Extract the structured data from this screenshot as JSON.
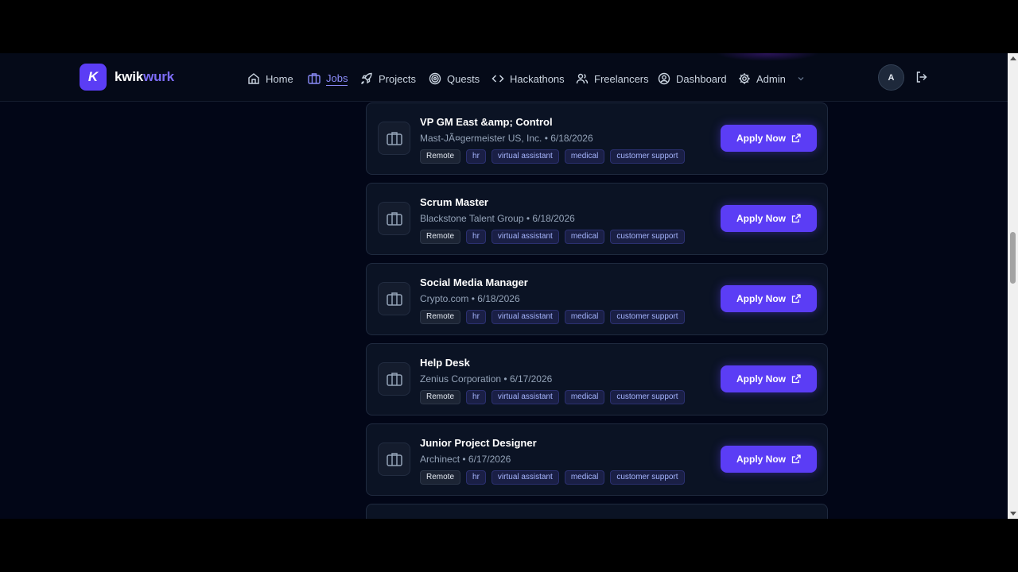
{
  "brand": {
    "logo_letter": "K",
    "name_part1": "kwik",
    "name_part2": "wurk"
  },
  "nav": [
    {
      "label": "Home",
      "icon": "home-icon",
      "active": false
    },
    {
      "label": "Jobs",
      "icon": "briefcase-icon",
      "active": true
    },
    {
      "label": "Projects",
      "icon": "rocket-icon",
      "active": false
    },
    {
      "label": "Quests",
      "icon": "target-icon",
      "active": false
    },
    {
      "label": "Hackathons",
      "icon": "code-icon",
      "active": false
    },
    {
      "label": "Freelancers",
      "icon": "users-icon",
      "active": false
    },
    {
      "label": "Dashboard",
      "icon": "user-circle-icon",
      "active": false
    },
    {
      "label": "Admin",
      "icon": "gear-icon",
      "active": false
    }
  ],
  "user": {
    "avatar_initial": "A"
  },
  "jobs": [
    {
      "title": "VP GM East &amp; Control",
      "company": "Mast-JÃ¤germeister US, Inc.",
      "date": "6/18/2026",
      "tags": [
        "Remote",
        "hr",
        "virtual assistant",
        "medical",
        "customer support"
      ],
      "apply_label": "Apply Now"
    },
    {
      "title": "Scrum Master",
      "company": "Blackstone Talent Group",
      "date": "6/18/2026",
      "tags": [
        "Remote",
        "hr",
        "virtual assistant",
        "medical",
        "customer support"
      ],
      "apply_label": "Apply Now"
    },
    {
      "title": "Social Media Manager",
      "company": "Crypto.com",
      "date": "6/18/2026",
      "tags": [
        "Remote",
        "hr",
        "virtual assistant",
        "medical",
        "customer support"
      ],
      "apply_label": "Apply Now"
    },
    {
      "title": "Help Desk",
      "company": "Zenius Corporation",
      "date": "6/17/2026",
      "tags": [
        "Remote",
        "hr",
        "virtual assistant",
        "medical",
        "customer support"
      ],
      "apply_label": "Apply Now"
    },
    {
      "title": "Junior Project Designer",
      "company": "Archinect",
      "date": "6/17/2026",
      "tags": [
        "Remote",
        "hr",
        "virtual assistant",
        "medical",
        "customer support"
      ],
      "apply_label": "Apply Now"
    }
  ],
  "colors": {
    "accent": "#5b3df5",
    "background": "#020617",
    "card": "#0b1324",
    "nav_active": "#8b8cf9"
  }
}
